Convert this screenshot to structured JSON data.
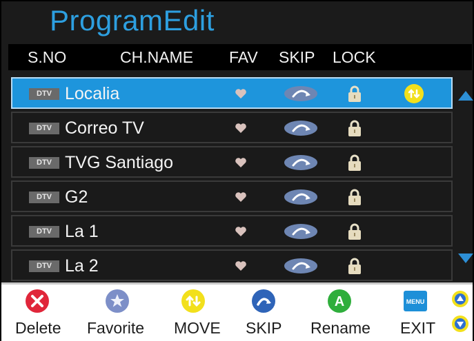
{
  "title": "ProgramEdit",
  "columns": {
    "sno": "S.NO",
    "chname": "CH.NAME",
    "fav": "FAV",
    "skip": "SKIP",
    "lock": "LOCK"
  },
  "channels": [
    {
      "type": "DTV",
      "name": "Localia",
      "selected": true,
      "move": true
    },
    {
      "type": "DTV",
      "name": "Correo TV",
      "selected": false,
      "move": false
    },
    {
      "type": "DTV",
      "name": "TVG Santiago",
      "selected": false,
      "move": false
    },
    {
      "type": "DTV",
      "name": "G2",
      "selected": false,
      "move": false
    },
    {
      "type": "DTV",
      "name": "La 1",
      "selected": false,
      "move": false
    },
    {
      "type": "DTV",
      "name": "La 2",
      "selected": false,
      "move": false
    }
  ],
  "footer": {
    "delete": "Delete",
    "favorite": "Favorite",
    "move": "MOVE",
    "skip": "SKIP",
    "rename": "Rename",
    "exit": "EXIT",
    "menu_badge": "MENU",
    "rename_badge": "A"
  },
  "colors": {
    "title": "#2d9fe0",
    "selected_row": "#1e95dc",
    "delete": "#e0263a",
    "favorite": "#7d8fc8",
    "move": "#f2e01c",
    "skip": "#2f64b8",
    "rename": "#2fae3c",
    "exit": "#1d8fd8"
  }
}
